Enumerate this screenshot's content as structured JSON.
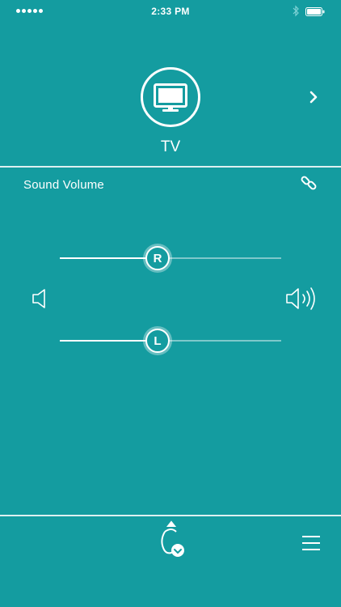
{
  "status_bar": {
    "time": "2:33 PM",
    "signal_icon": "signal-dots-icon",
    "bluetooth_icon": "bluetooth-icon",
    "battery_icon": "battery-icon"
  },
  "device": {
    "name": "TV",
    "icon": "tv-icon",
    "next_icon": "chevron-right-icon"
  },
  "volume": {
    "title": "Sound Volume",
    "link_icon": "link-icon",
    "right": {
      "label": "R",
      "level": 0.44
    },
    "left": {
      "label": "L",
      "level": 0.44
    },
    "low_icon": "speaker-low-icon",
    "high_icon": "speaker-high-icon"
  },
  "bottom_bar": {
    "hearing_icon": "hearing-aid-icon",
    "menu_icon": "menu-icon"
  },
  "colors": {
    "background": "#149ca0",
    "foreground": "#ffffff"
  }
}
